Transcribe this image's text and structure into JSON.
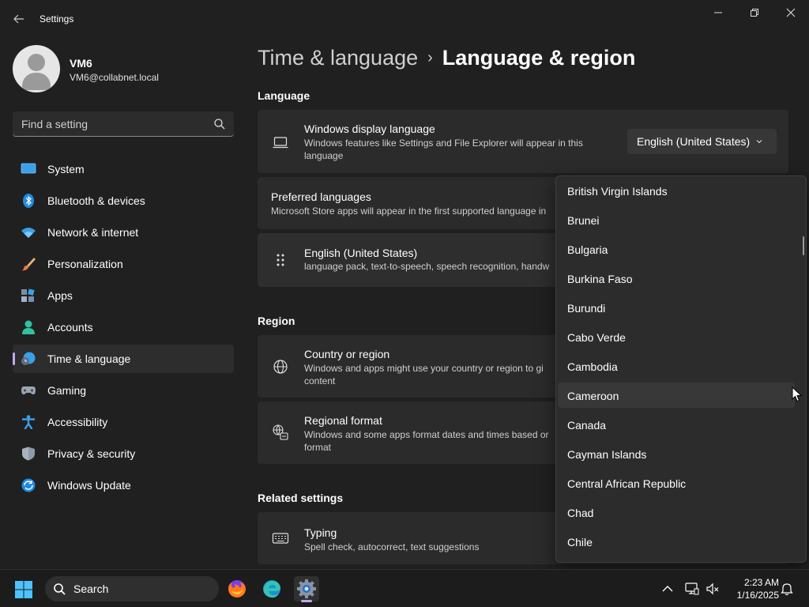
{
  "window": {
    "title": "Settings",
    "controls": {
      "minimize": "minimize",
      "maximize": "restore",
      "close": "close"
    }
  },
  "profile": {
    "name": "VM6",
    "email": "VM6@collabnet.local"
  },
  "search": {
    "placeholder": "Find a setting"
  },
  "sidebar": {
    "items": [
      {
        "label": "System",
        "icon": "system-icon"
      },
      {
        "label": "Bluetooth & devices",
        "icon": "bluetooth-icon"
      },
      {
        "label": "Network & internet",
        "icon": "wifi-icon"
      },
      {
        "label": "Personalization",
        "icon": "brush-icon"
      },
      {
        "label": "Apps",
        "icon": "apps-icon"
      },
      {
        "label": "Accounts",
        "icon": "accounts-icon"
      },
      {
        "label": "Time & language",
        "icon": "time-language-icon",
        "active": true
      },
      {
        "label": "Gaming",
        "icon": "gamepad-icon"
      },
      {
        "label": "Accessibility",
        "icon": "accessibility-icon"
      },
      {
        "label": "Privacy & security",
        "icon": "shield-icon"
      },
      {
        "label": "Windows Update",
        "icon": "update-icon"
      }
    ]
  },
  "breadcrumb": {
    "parent": "Time & language",
    "separator": "›",
    "current": "Language & region"
  },
  "language": {
    "section_title": "Language",
    "display": {
      "title": "Windows display language",
      "description": "Windows features like Settings and File Explorer will appear in this language",
      "selected": "English (United States)"
    },
    "preferred": {
      "title": "Preferred languages",
      "description": "Microsoft Store apps will appear in the first supported language in"
    },
    "installed": {
      "title": "English (United States)",
      "description": "language pack, text-to-speech, speech recognition, handw"
    }
  },
  "region": {
    "section_title": "Region",
    "country": {
      "title": "Country or region",
      "description": "Windows and apps might use your country or region to gi content"
    },
    "format": {
      "title": "Regional format",
      "description": "Windows and some apps format dates and times based or format"
    }
  },
  "related": {
    "section_title": "Related settings",
    "typing": {
      "title": "Typing",
      "description": "Spell check, autocorrect, text suggestions"
    }
  },
  "country_dropdown": {
    "items": [
      "British Virgin Islands",
      "Brunei",
      "Bulgaria",
      "Burkina Faso",
      "Burundi",
      "Cabo Verde",
      "Cambodia",
      "Cameroon",
      "Canada",
      "Cayman Islands",
      "Central African Republic",
      "Chad",
      "Chile"
    ],
    "hovered": "Cameroon"
  },
  "taskbar": {
    "search_label": "Search",
    "apps": [
      "firefox-icon",
      "edge-icon",
      "settings-icon"
    ],
    "tray": {
      "time": "2:23 AM",
      "date": "1/16/2025"
    }
  },
  "colors": {
    "accent": "#c1a8f0",
    "background": "#202020",
    "card": "#2b2b2b"
  }
}
